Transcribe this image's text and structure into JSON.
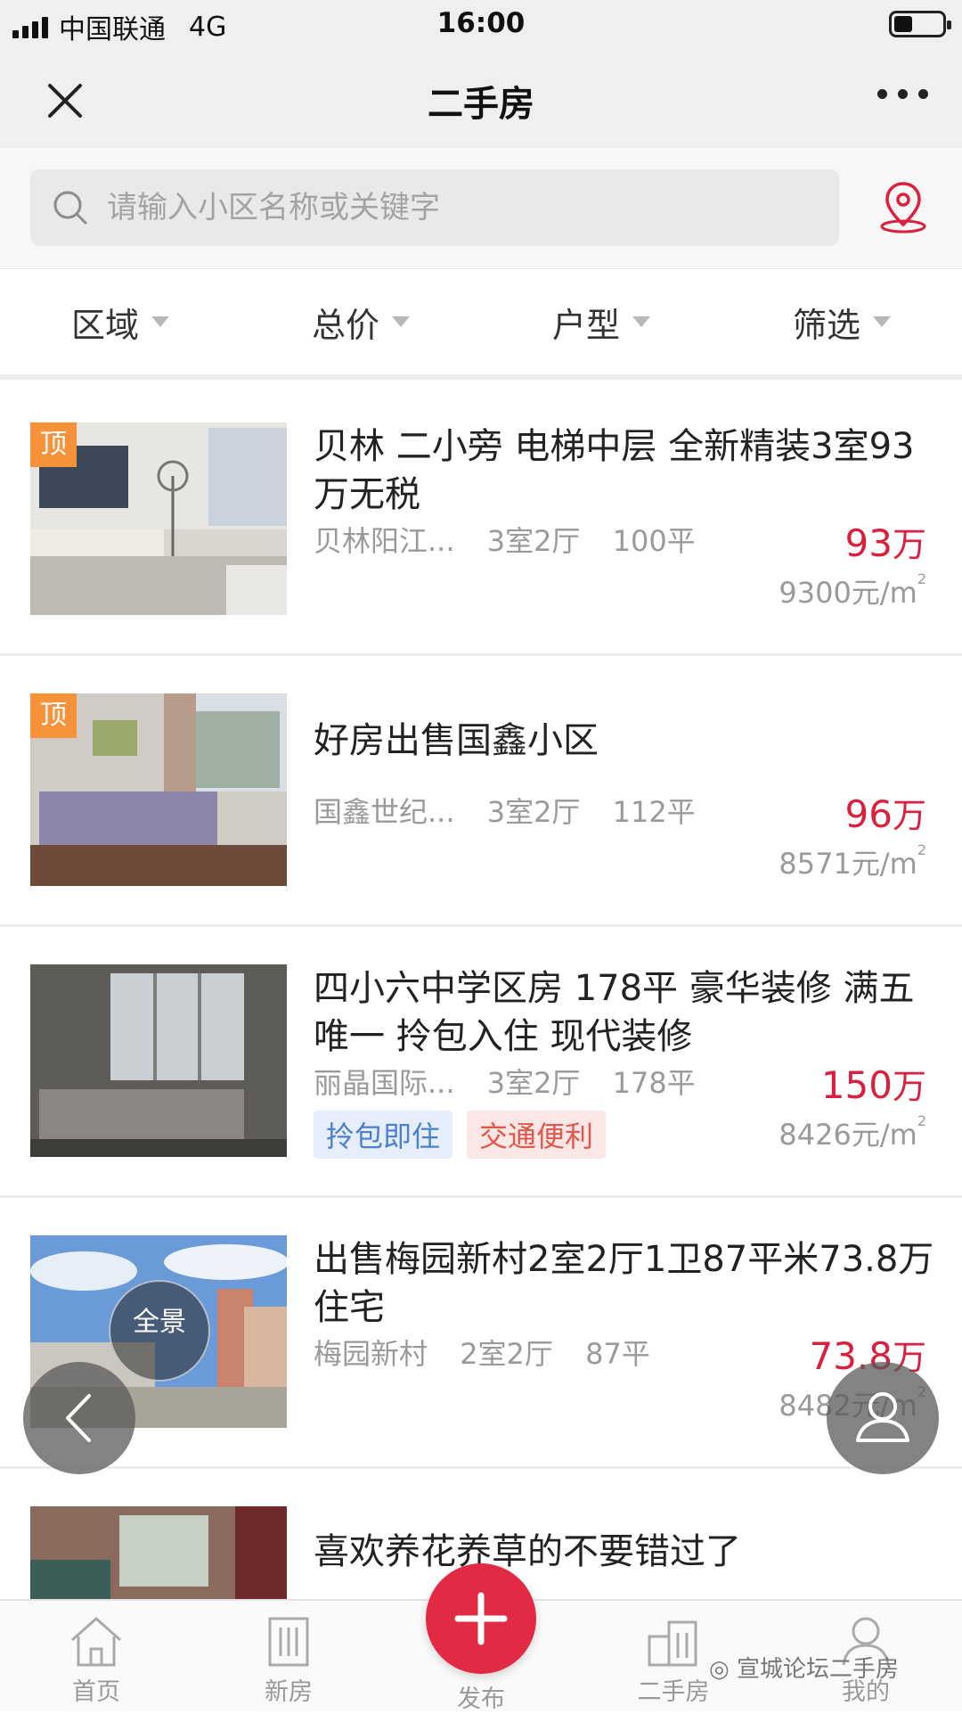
{
  "status_bar": {
    "carrier": "中国联通",
    "network": "4G",
    "time": "16:00"
  },
  "header": {
    "title": "二手房"
  },
  "search": {
    "placeholder": "请输入小区名称或关键字"
  },
  "filters": [
    {
      "label": "区域"
    },
    {
      "label": "总价"
    },
    {
      "label": "户型"
    },
    {
      "label": "筛选"
    }
  ],
  "listings": [
    {
      "badge": "顶",
      "title": "贝林 二小旁 电梯中层 全新精装3室93万无税",
      "community": "贝林阳江...",
      "layout": "3室2厅",
      "area": "100平",
      "price": "93",
      "price_unit": "万",
      "unit_price": "9300元/m",
      "unit_sup": "2"
    },
    {
      "badge": "顶",
      "title": "好房出售国鑫小区",
      "community": "国鑫世纪...",
      "layout": "3室2厅",
      "area": "112平",
      "price": "96",
      "price_unit": "万",
      "unit_price": "8571元/m",
      "unit_sup": "2"
    },
    {
      "title": "四小六中学区房 178平 豪华装修 满五唯一 拎包入住 现代装修",
      "community": "丽晶国际...",
      "layout": "3室2厅",
      "area": "178平",
      "price": "150",
      "price_unit": "万",
      "unit_price": "8426元/m",
      "unit_sup": "2",
      "tags": [
        "拎包即住",
        "交通便利"
      ]
    },
    {
      "pano": "全景",
      "title": "出售梅园新村2室2厅1卫87平米73.8万住宅",
      "community": "梅园新村",
      "layout": "2室2厅",
      "area": "87平",
      "price": "73.8",
      "price_unit": "万",
      "unit_price": "8482元/m",
      "unit_sup": "2"
    },
    {
      "title": "喜欢养花养草的不要错过了"
    }
  ],
  "tab_bar": {
    "home": "首页",
    "new": "新房",
    "publish": "发布",
    "second_hand": "二手房",
    "mine": "我的"
  },
  "watermark": "宣城论坛二手房",
  "colors": {
    "accent": "#d9213f",
    "badge": "#f7913a"
  }
}
